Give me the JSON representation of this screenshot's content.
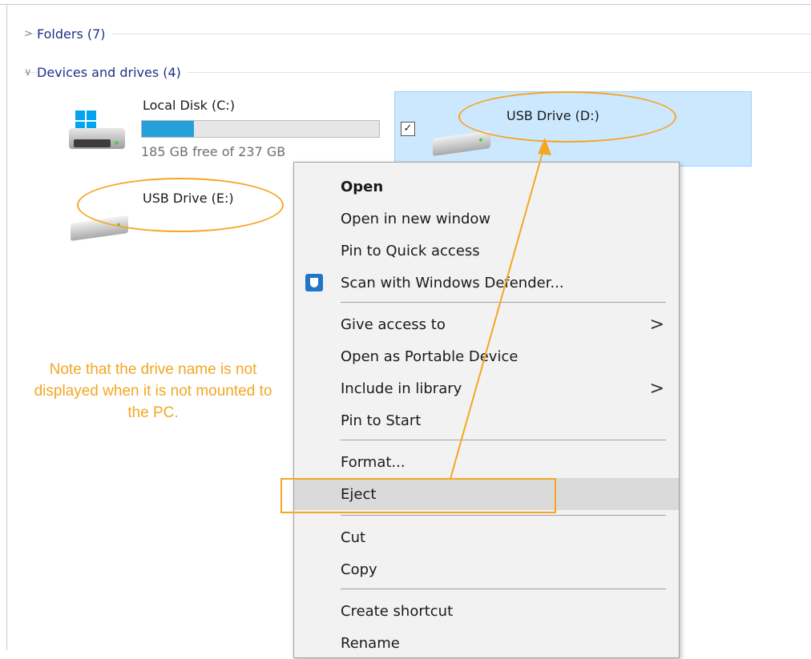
{
  "groups": {
    "folders": {
      "chevron": ">",
      "label": "Folders (7)"
    },
    "devices": {
      "chevron": "∨",
      "label": "Devices and drives (4)"
    }
  },
  "drives": {
    "c": {
      "name": "Local Disk (C:)",
      "free_text": "185 GB free of 237 GB",
      "used_fraction": 0.22
    },
    "d": {
      "name": "USB Drive (D:)",
      "checkbox": "✓"
    },
    "e": {
      "name": "USB Drive (E:)"
    }
  },
  "annotation": {
    "note": "Note that the drive name is not displayed when it is not mounted to the PC.",
    "color": "#f5a623"
  },
  "context_menu": {
    "items": [
      {
        "label": "Open",
        "bold": true
      },
      {
        "label": "Open in new window"
      },
      {
        "label": "Pin to Quick access"
      },
      {
        "label": "Scan with Windows Defender...",
        "icon": "windows-defender-icon"
      },
      {
        "label": "Give access to",
        "submenu_glyph": ">"
      },
      {
        "label": "Open as Portable Device"
      },
      {
        "label": "Include in library",
        "submenu_glyph": ">"
      },
      {
        "label": "Pin to Start"
      },
      {
        "label": "Format..."
      },
      {
        "label": "Eject",
        "highlighted": true
      },
      {
        "label": "Cut"
      },
      {
        "label": "Copy"
      },
      {
        "label": "Create shortcut"
      },
      {
        "label": "Rename"
      }
    ]
  },
  "colors": {
    "selection": "#cce8ff",
    "progress": "#26a0da",
    "group_header": "#1e3287",
    "accent": "#f5a623"
  }
}
